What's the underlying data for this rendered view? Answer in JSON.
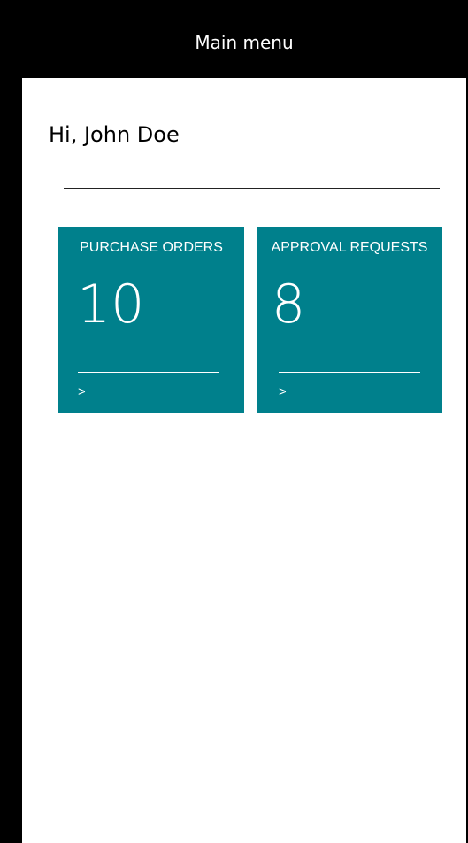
{
  "header": {
    "title": "Main menu"
  },
  "greeting": "Hi, John Doe",
  "tiles": [
    {
      "label": "PURCHASE ORDERS",
      "count": "10",
      "arrow": ">"
    },
    {
      "label": "APPROVAL REQUESTS",
      "count": "8",
      "arrow": ">"
    }
  ],
  "colors": {
    "header_bg": "#000000",
    "tile_bg": "#00808c",
    "tile_text": "#ffffff"
  }
}
